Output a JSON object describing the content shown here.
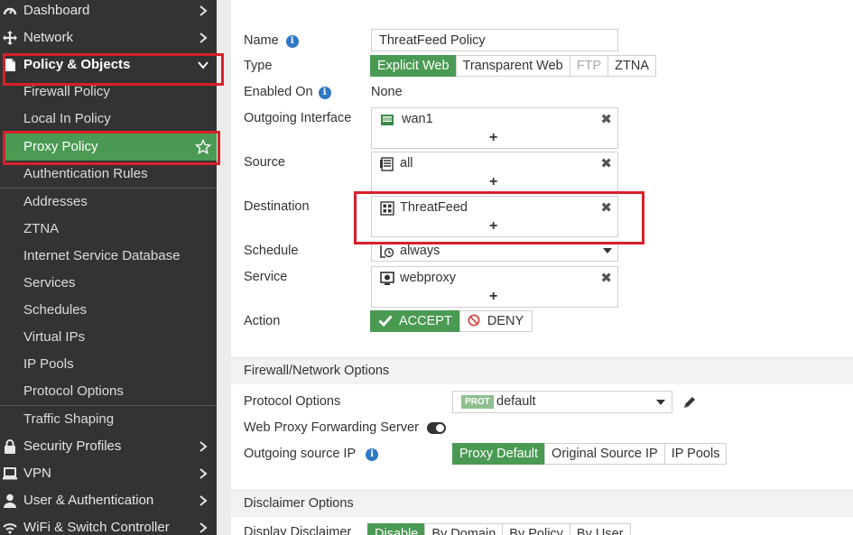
{
  "sidebar": {
    "items": [
      {
        "label": "Dashboard",
        "icon": "dashboard-icon"
      },
      {
        "label": "Network",
        "icon": "network-icon"
      },
      {
        "label": "Policy & Objects",
        "icon": "policy-objects-icon"
      },
      {
        "label": "Firewall Policy"
      },
      {
        "label": "Local In Policy"
      },
      {
        "label": "Proxy Policy"
      },
      {
        "label": "Authentication Rules"
      },
      {
        "label": "Addresses"
      },
      {
        "label": "ZTNA"
      },
      {
        "label": "Internet Service Database"
      },
      {
        "label": "Services"
      },
      {
        "label": "Schedules"
      },
      {
        "label": "Virtual IPs"
      },
      {
        "label": "IP Pools"
      },
      {
        "label": "Protocol Options"
      },
      {
        "label": "Traffic Shaping"
      },
      {
        "label": "Security Profiles",
        "icon": "lock-icon"
      },
      {
        "label": "VPN",
        "icon": "laptop-icon"
      },
      {
        "label": "User & Authentication",
        "icon": "user-icon"
      },
      {
        "label": "WiFi & Switch Controller",
        "icon": "wifi-icon"
      }
    ],
    "active_color": "#4a9a53",
    "highlight_color": "#d8202b"
  },
  "form": {
    "name_label": "Name",
    "name_value": "ThreatFeed Policy",
    "type_label": "Type",
    "type_options": [
      "Explicit Web",
      "Transparent Web",
      "FTP",
      "ZTNA"
    ],
    "type_selected": "Explicit Web",
    "enabled_on_label": "Enabled On",
    "enabled_on_value": "None",
    "outgoing_interface_label": "Outgoing Interface",
    "outgoing_interface_value": "wan1",
    "source_label": "Source",
    "source_value": "all",
    "destination_label": "Destination",
    "destination_value": "ThreatFeed",
    "schedule_label": "Schedule",
    "schedule_value": "always",
    "service_label": "Service",
    "service_value": "webproxy",
    "action_label": "Action",
    "action_accept": "ACCEPT",
    "action_deny": "DENY",
    "add_symbol": "+",
    "remove_symbol": "✖"
  },
  "firewall_options": {
    "title": "Firewall/Network Options",
    "protocol_options_label": "Protocol Options",
    "protocol_badge": "PROT",
    "protocol_value": "default",
    "forwarding_label": "Web Proxy Forwarding Server",
    "outgoing_ip_label": "Outgoing source IP",
    "outgoing_ip_options": [
      "Proxy Default",
      "Original Source IP",
      "IP Pools"
    ]
  },
  "disclaimer": {
    "title": "Disclaimer Options",
    "display_label": "Display Disclaimer",
    "options": [
      "Disable",
      "By Domain",
      "By Policy",
      "By User"
    ]
  }
}
